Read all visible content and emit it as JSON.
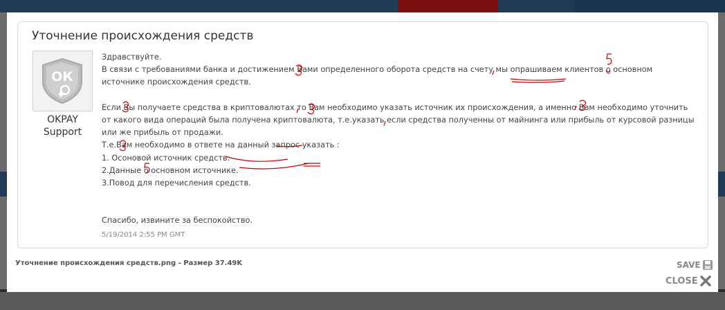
{
  "ticket": {
    "title": "Уточнение происхождения средств",
    "sender": "OKPAY Support",
    "avatar_icon": "okpay-shield-logo",
    "lines": [
      "Здравствуйте.",
      "В связи с требованиями банка и достижением Вами определенного оборота средств на счету мы опрашиваем клиентов о основном",
      "источнике происхождения средств.",
      "Если Вы получаете средства в криптовалютах то Вам необходимо указать источник их происхождения, а именно Вам необходимо уточнить",
      "от какого вида операций была получена криптовалюта, т.е.указать если средства полученны от майнинга или прибыль от курсовой разницы",
      "или же прибыль от продажи.",
      "Т.е.Вам необходимо в ответе на данный запрос указать :",
      "1. Осоновой источник средств.",
      "2.Данные о основном источнике.",
      "3.Повод для перечисления средств.",
      "Спасибо, извините за беспокойство."
    ],
    "timestamp": "5/19/2014 2:55 PM GMT"
  },
  "footer": {
    "file_caption": "Уточнение происхождения средств.png - Размер 37.49K",
    "save_label": "SAVE",
    "save_icon": "floppy-disk-icon",
    "close_label": "CLOSE",
    "close_icon": "close-x-icon"
  },
  "colors": {
    "annotation": "#cc0000",
    "title": "#333333",
    "body_text": "#444444"
  }
}
